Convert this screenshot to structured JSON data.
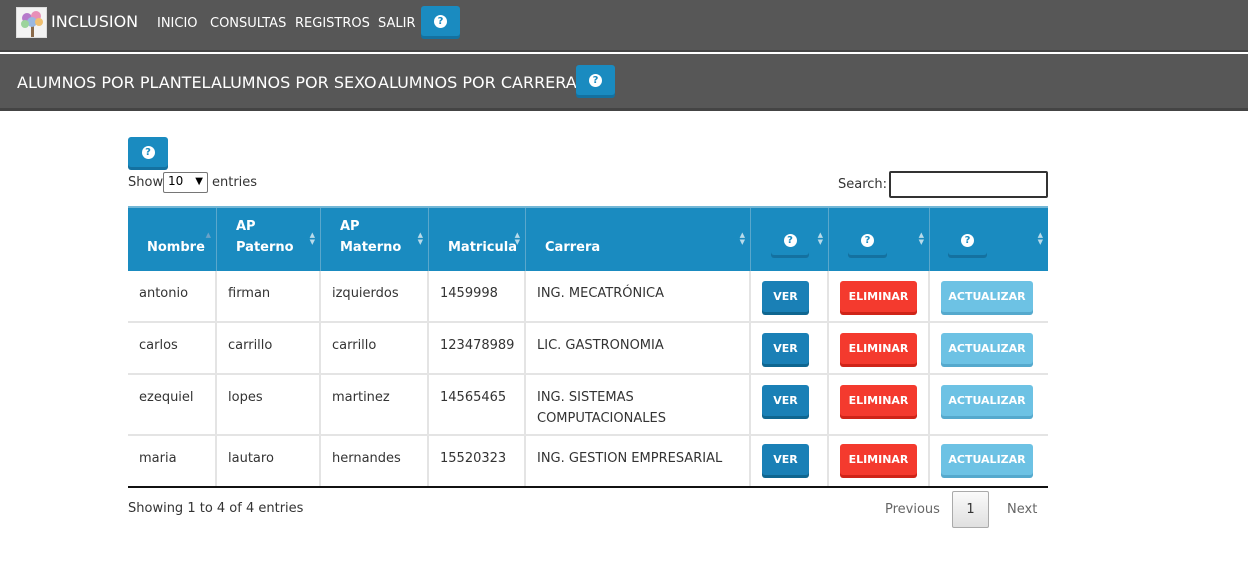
{
  "app": {
    "title": "INCLUSION"
  },
  "top_nav": {
    "items": [
      "INICIO",
      "CONSULTAS",
      "REGISTROS",
      "SALIR"
    ],
    "help": "?"
  },
  "sub_nav": {
    "items": [
      "ALUMNOS POR PLANTEL",
      "ALUMNOS POR SEXO",
      "ALUMNOS POR CARRERA"
    ],
    "help": "?"
  },
  "table_help": "?",
  "length_control": {
    "prefix": "Show",
    "value": "10",
    "suffix": "entries"
  },
  "search": {
    "label": "Search:",
    "value": ""
  },
  "columns": [
    {
      "line1": "",
      "line2": "Nombre"
    },
    {
      "line1": "AP",
      "line2": "Paterno"
    },
    {
      "line1": "AP",
      "line2": "Materno"
    },
    {
      "line1": "",
      "line2": "Matricula"
    },
    {
      "line1": "",
      "line2": "Carrera"
    },
    {
      "help": "?"
    },
    {
      "help": "?"
    },
    {
      "help": "?"
    }
  ],
  "rows": [
    {
      "nombre": "antonio",
      "paterno": "firman",
      "materno": "izquierdos",
      "matricula": "1459998",
      "carrera_1": "ING. MECATRÓNICA",
      "carrera_2": ""
    },
    {
      "nombre": "carlos",
      "paterno": "carrillo",
      "materno": "carrillo",
      "matricula": "123478989",
      "carrera_1": "LIC. GASTRONOMIA",
      "carrera_2": ""
    },
    {
      "nombre": "ezequiel",
      "paterno": "lopes",
      "materno": "martinez",
      "matricula": "14565465",
      "carrera_1": "ING. SISTEMAS",
      "carrera_2": "COMPUTACIONALES"
    },
    {
      "nombre": "maria",
      "paterno": "lautaro",
      "materno": "hernandes",
      "matricula": "15520323",
      "carrera_1": "ING. GESTION EMPRESARIAL",
      "carrera_2": ""
    }
  ],
  "actions": {
    "view": "VER",
    "delete": "ELIMINAR",
    "update": "ACTUALIZAR"
  },
  "footer": {
    "info": "Showing 1 to 4 of 4 entries",
    "previous": "Previous",
    "page": "1",
    "next": "Next"
  },
  "colors": {
    "navbar": "#575757",
    "table_header": "#1a8bc0",
    "view": "#1a80b6",
    "delete": "#f43a2e",
    "update": "#6dc2e4"
  }
}
